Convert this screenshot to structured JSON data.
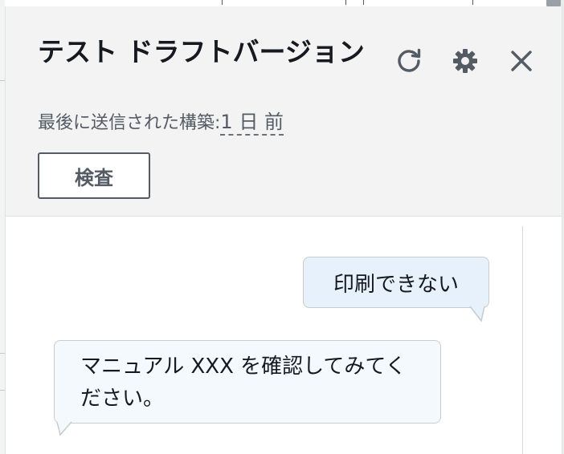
{
  "panel": {
    "title": "テスト ドラフトバージョン",
    "subtitle_prefix": "最後に送信された構築:",
    "subtitle_time": "1 日 前",
    "inspect_label": "検査",
    "icons": {
      "refresh": "refresh-icon",
      "settings": "gear-icon",
      "close": "close-icon"
    }
  },
  "chat": {
    "messages": [
      {
        "role": "user",
        "text": "印刷できない"
      },
      {
        "role": "bot",
        "text": "マニュアル XXX を確認してみてください。"
      }
    ]
  },
  "colors": {
    "header_bg": "#f3f3f3",
    "user_bubble": "#e6f1fb",
    "bot_bubble": "#f4f9fd",
    "text_dark": "#16191f",
    "text_muted": "#545b64"
  }
}
